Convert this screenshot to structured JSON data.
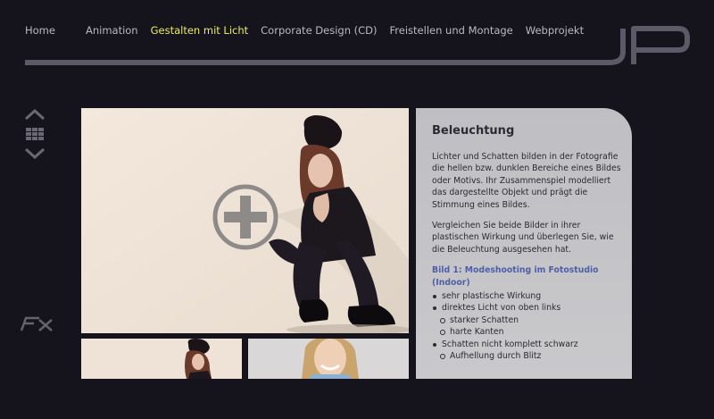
{
  "nav": {
    "items": [
      {
        "label": "Home"
      },
      {
        "label": "Animation"
      },
      {
        "label": "Gestalten mit Licht"
      },
      {
        "label": "Corporate Design (CD)"
      },
      {
        "label": "Freistellen und Montage"
      },
      {
        "label": "Webprojekt"
      }
    ],
    "active_color": "#e8ec5a"
  },
  "panel": {
    "title": "Beleuchtung",
    "paragraph1": "Lichter und Schatten bilden in der Fotografie die hellen bzw. dunklen Bereiche eines Bildes oder Motivs. Ihr Zusammenspiel modelliert das dargestellte Objekt und prägt die Stimmung eines Bildes.",
    "paragraph2": "Vergleichen Sie beide Bilder in ihrer plastischen Wirkung und überlegen Sie, wie die Beleuchtung ausgesehen hat.",
    "subtitle": "Bild 1: Modeshooting im Fotostudio (Indoor)",
    "bullets": [
      {
        "text": "sehr plastische Wirkung"
      },
      {
        "text": "direktes Licht von oben links"
      },
      {
        "text": "starker Schatten"
      },
      {
        "text": "harte Kanten"
      },
      {
        "text": "Schatten nicht komplett schwarz"
      },
      {
        "text": "Aufhellung durch Blitz"
      }
    ]
  },
  "icons": {
    "zoom": "plus-circle-icon",
    "scroll_up": "chevron-up-icon",
    "scroll_down": "chevron-down-icon",
    "grid": "grid-icon"
  },
  "colors": {
    "background": "#15141d",
    "nav_text": "#b9b9be",
    "nav_active": "#e8ec5a",
    "panel": "#c3c3c6",
    "subtitle": "#4d5fa8"
  }
}
